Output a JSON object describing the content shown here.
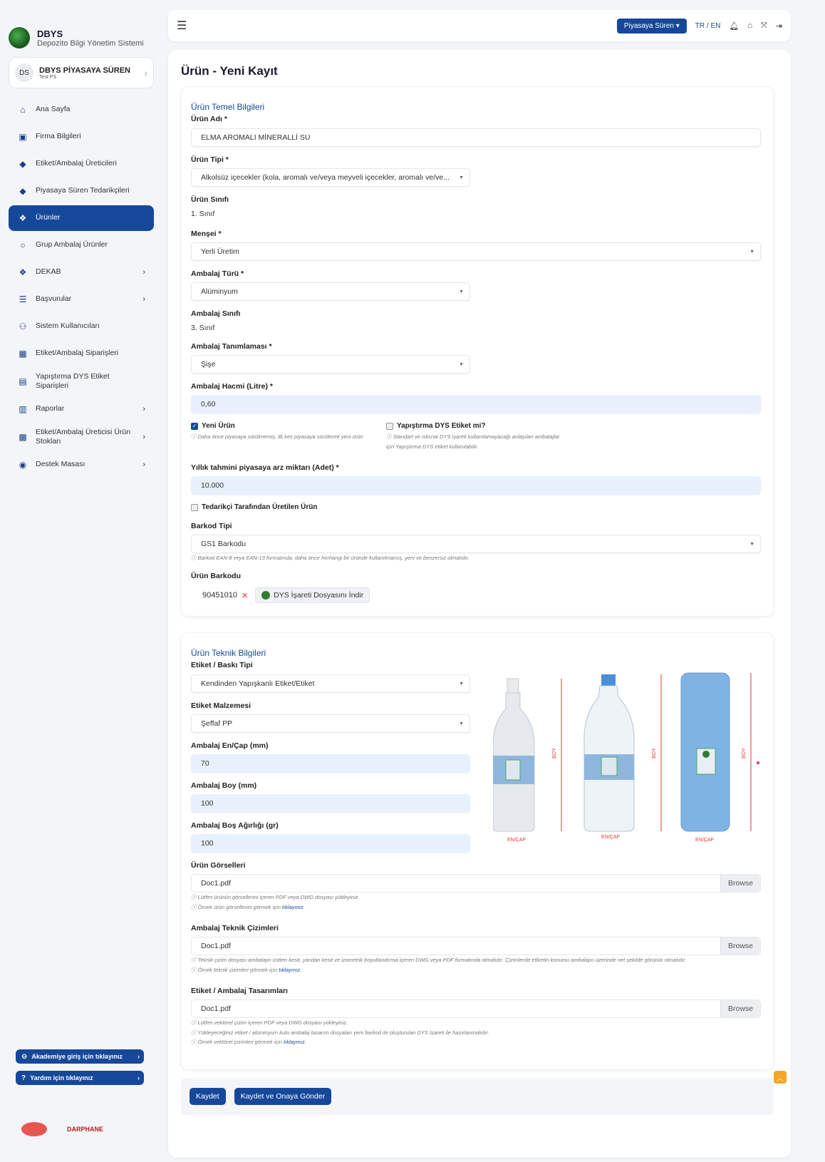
{
  "app": {
    "name": "DBYS",
    "subtitle": "Depozito Bilgi Yönetim Sistemi"
  },
  "user": {
    "initials": "DS",
    "name": "DBYS PİYASAYA SÜREN",
    "role": "Test PS"
  },
  "sidebar": {
    "items": [
      {
        "label": "Ana Sayfa",
        "icon": "home-icon",
        "glyph": "⌂"
      },
      {
        "label": "Firma Bilgileri",
        "icon": "briefcase-icon",
        "glyph": "▣"
      },
      {
        "label": "Etiket/Ambalaj Üreticileri",
        "icon": "tag-icon",
        "glyph": "◆"
      },
      {
        "label": "Piyasaya Süren Tedarikçileri",
        "icon": "tag-icon",
        "glyph": "◆"
      },
      {
        "label": "Ürünler",
        "icon": "cubes-icon",
        "glyph": "❖"
      },
      {
        "label": "Grup Ambalaj Ürünler",
        "icon": "circle-icon",
        "glyph": "○"
      },
      {
        "label": "DEKAB",
        "icon": "cubes-icon",
        "glyph": "❖"
      },
      {
        "label": "Başvurular",
        "icon": "list-icon",
        "glyph": "☰"
      },
      {
        "label": "Sistem Kullanıcıları",
        "icon": "users-icon",
        "glyph": "⚇"
      },
      {
        "label": "Etiket/Ambalaj Siparişleri",
        "icon": "grid-icon",
        "glyph": "▦"
      },
      {
        "label": "Yapıştırma DYS Etiket Siparişleri",
        "icon": "sticker-icon",
        "glyph": "▤"
      },
      {
        "label": "Raporlar",
        "icon": "building-icon",
        "glyph": "▥"
      },
      {
        "label": "Etiket/Ambalaj Üreticisi Ürün Stokları",
        "icon": "boxes-icon",
        "glyph": "▩"
      },
      {
        "label": "Destek Masası",
        "icon": "support-icon",
        "glyph": "◉"
      }
    ],
    "academy_btn": "Akademiye giriş için tıklayınız",
    "help_btn": "Yardım için tıklayınız",
    "logo2": "DARPHANE"
  },
  "topbar": {
    "role_btn": "Piyasaya Süren",
    "lang": "TR / EN"
  },
  "page": {
    "title": "Ürün - Yeni Kayıt"
  },
  "basic": {
    "section": "Ürün Temel Bilgileri",
    "name_label": "Ürün Adı *",
    "name_value": "ELMA AROMALI MİNERALLİ SU",
    "type_label": "Ürün Tipi *",
    "type_value": "Alkolsüz içecekler (kola, aromalı ve/veya meyveli içecekler, aromalı ve/ve...",
    "class_label": "Ürün Sınıfı",
    "class_value": "1. Sınıf",
    "origin_label": "Menşei *",
    "origin_value": "Yerli Üretim",
    "pack_type_label": "Ambalaj Türü *",
    "pack_type_value": "Alüminyum",
    "pack_class_label": "Ambalaj Sınıfı",
    "pack_class_value": "3. Sınıf",
    "pack_def_label": "Ambalaj Tanımlaması *",
    "pack_def_value": "Şişe",
    "volume_label": "Ambalaj Hacmi (Litre) *",
    "volume_value": "0,60",
    "new_label": "Yeni Ürün",
    "new_hint": "ⓘ Daha önce piyasaya sürülmemiş, ilk kez piyasaya sürülecek yeni ürün",
    "sticker_label": "Yapıştırma DYS Etiket mi?",
    "sticker_hint": "ⓘ Standart ve istisnai DYS işareti kullanılamayacağı anlaşılan ambalajlar için Yapıştırma DYS etiket kullanılabilir.",
    "annual_label": "Yıllık tahmini piyasaya arz miktarı (Adet) *",
    "annual_value": "10.000",
    "supplier_label": "Tedarikçi Tarafından Üretilen Ürün",
    "barcode_type_label": "Barkod Tipi",
    "barcode_type_value": "GS1 Barkodu",
    "barcode_hint": "ⓘ Barkod EAN-8 veya EAN-13 formatında, daha önce herhangi bir üründe kullanılmamış, yeni ve benzersiz olmalıdır.",
    "barcode_label": "Ürün Barkodu",
    "barcode_value": "90451010",
    "download_btn": "DYS İşareti Dosyasını İndir"
  },
  "tech": {
    "section": "Ürün Teknik Bilgileri",
    "print_label": "Etiket / Baskı Tipi",
    "print_value": "Kendinden Yapışkanlı Etiket/Etiket",
    "material_label": "Etiket Malzemesi",
    "material_value": "Şeffaf PP",
    "width_label": "Ambalaj En/Çap (mm)",
    "width_value": "70",
    "height_label": "Ambalaj Boy (mm)",
    "height_value": "100",
    "weight_label": "Ambalaj Boş Ağırlığı (gr)",
    "weight_value": "100",
    "illus_boy": "BOY",
    "illus_en": "EN/ÇAP",
    "images_label": "Ürün Görselleri",
    "images_file": "Doc1.pdf",
    "images_hint1": "ⓘ Lütfen ürünün görsellerini içeren PDF veya DWG dosyası yükleyiniz.",
    "images_hint2": "ⓘ Örnek ürün görsellerini görmek için",
    "drawings_label": "Ambalaj Teknik Çizimleri",
    "drawings_file": "Doc1.pdf",
    "drawings_hint1": "ⓘ Teknik çizim dosyası ambalajın üstten kesit, yandan kesit ve izometrik boyutlandırma içeren DWG veya PDF formatında olmalıdır. Çizimlerde etiketin konumu ambalajın üzerinde net şekilde görünür olmalıdır.",
    "drawings_hint2": "ⓘ Örnek teknik çizimleri görmek için",
    "designs_label": "Etiket / Ambalaj Tasarımları",
    "designs_file": "Doc1.pdf",
    "designs_hint1": "ⓘ Lütfen vektörel çizim içeren PDF veya DWG dosyası yükleyiniz.",
    "designs_hint2": "ⓘ Yükleyeceğiniz etiket / alüminyum kutu ambalaj tasarım dosyaları yeni barkod ile oluşturulan DYS İşareti ile hazırlanmalıdır.",
    "designs_hint3": "ⓘ Örnek vektörel çizimleri görmek için",
    "link": "tıklayınız.",
    "browse": "Browse"
  },
  "actions": {
    "save": "Kaydet",
    "save_send": "Kaydet ve Onaya Gönder"
  },
  "colors": {
    "primary": "#16489a",
    "input_fill": "#e8f0fe",
    "danger": "#e53935",
    "accent": "#f5a623"
  }
}
